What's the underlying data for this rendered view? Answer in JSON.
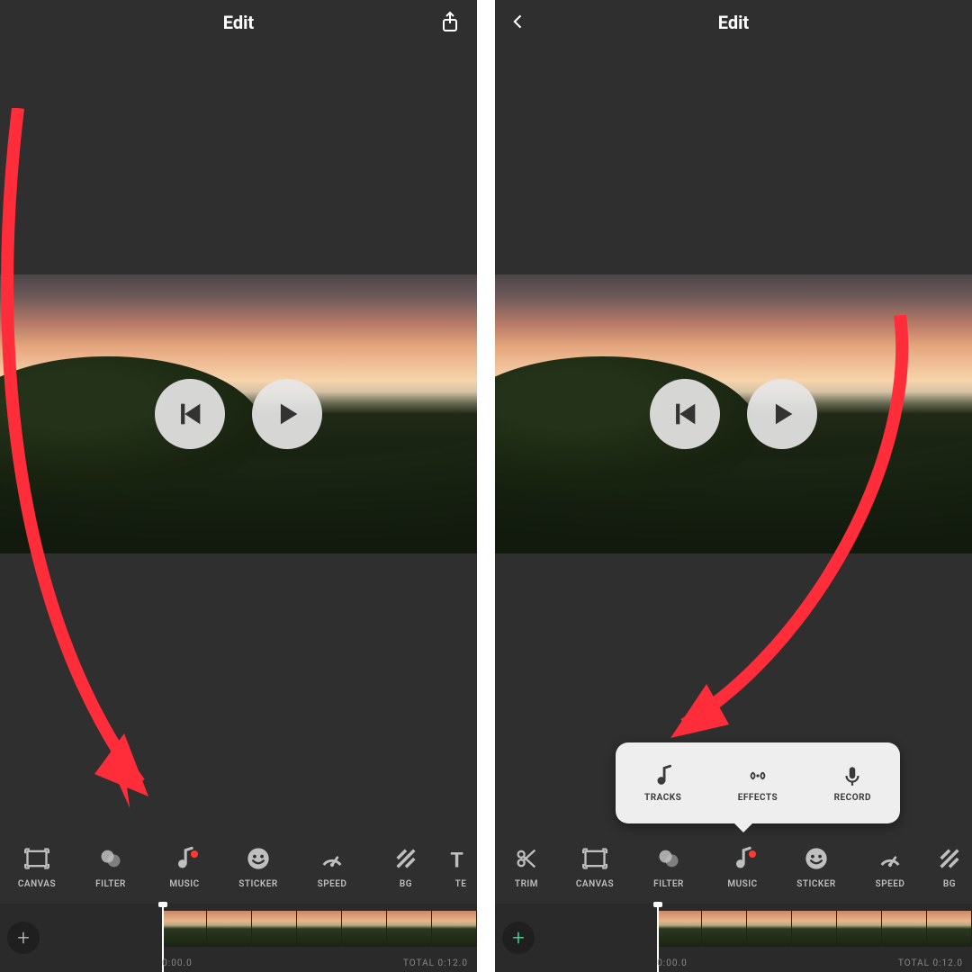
{
  "left": {
    "header": {
      "title": "Edit"
    },
    "toolbar": [
      {
        "id": "canvas",
        "label": "CANVAS",
        "icon": "canvas-icon"
      },
      {
        "id": "filter",
        "label": "FILTER",
        "icon": "filter-icon"
      },
      {
        "id": "music",
        "label": "MUSIC",
        "icon": "music-icon",
        "badge": true
      },
      {
        "id": "sticker",
        "label": "STICKER",
        "icon": "sticker-icon"
      },
      {
        "id": "speed",
        "label": "SPEED",
        "icon": "speed-icon"
      },
      {
        "id": "bg",
        "label": "BG",
        "icon": "bg-icon"
      },
      {
        "id": "te",
        "label": "TE",
        "icon": "text-icon"
      }
    ],
    "timeline": {
      "current": "0:00.0",
      "total": "TOTAL 0:12.0"
    }
  },
  "right": {
    "header": {
      "title": "Edit"
    },
    "popup": [
      {
        "id": "tracks",
        "label": "TRACKS",
        "icon": "music-icon"
      },
      {
        "id": "effects",
        "label": "EFFECTS",
        "icon": "effects-icon"
      },
      {
        "id": "record",
        "label": "RECORD",
        "icon": "mic-icon"
      }
    ],
    "toolbar": [
      {
        "id": "trim",
        "label": "TRIM",
        "icon": "trim-icon"
      },
      {
        "id": "canvas",
        "label": "CANVAS",
        "icon": "canvas-icon"
      },
      {
        "id": "filter",
        "label": "FILTER",
        "icon": "filter-icon"
      },
      {
        "id": "music",
        "label": "MUSIC",
        "icon": "music-icon",
        "badge": true
      },
      {
        "id": "sticker",
        "label": "STICKER",
        "icon": "sticker-icon"
      },
      {
        "id": "speed",
        "label": "SPEED",
        "icon": "speed-icon"
      },
      {
        "id": "bg",
        "label": "BG",
        "icon": "bg-icon"
      }
    ],
    "timeline": {
      "current": "0:00.0",
      "total": "TOTAL 0:12.0"
    }
  },
  "colors": {
    "accent_red": "#ff3b30",
    "add_plus": "#2ee59d"
  }
}
